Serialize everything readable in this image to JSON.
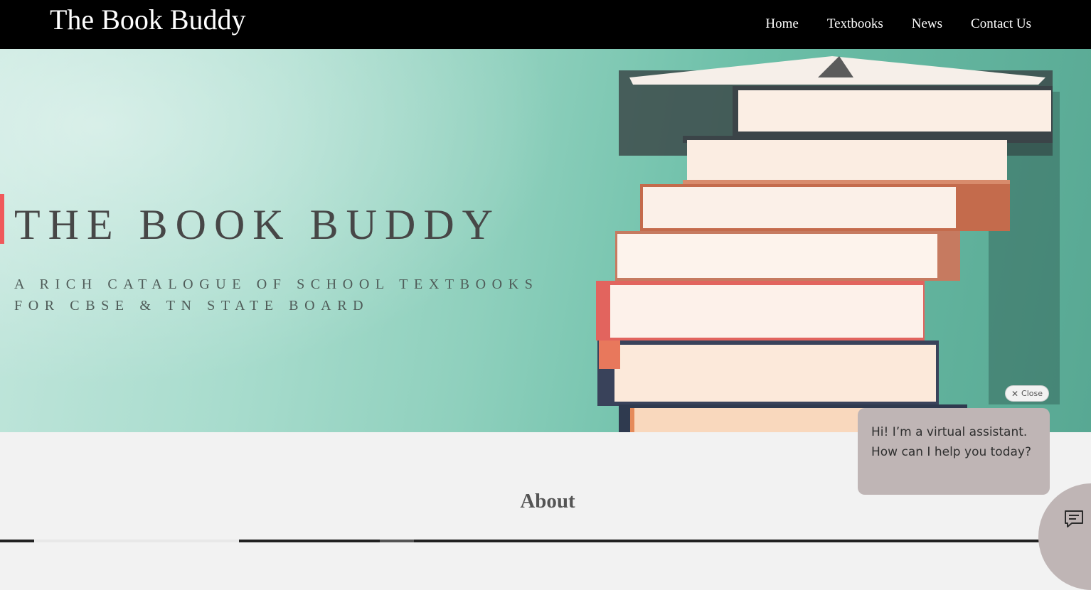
{
  "header": {
    "site_title": "The Book Buddy",
    "nav": [
      {
        "label": "Home"
      },
      {
        "label": "Textbooks"
      },
      {
        "label": "News"
      },
      {
        "label": "Contact Us"
      }
    ]
  },
  "hero": {
    "title": "THE BOOK BUDDY",
    "subtitle": "A RICH CATALOGUE OF SCHOOL TEXTBOOKS FOR CBSE & TN STATE BOARD",
    "accent_color": "#f0595b"
  },
  "about": {
    "title": "About"
  },
  "chat": {
    "close_label": "Close",
    "message": "Hi! I’m a virtual assistant. How can I help you today?",
    "launcher_icon": "chat-icon"
  },
  "colors": {
    "header_bg": "#000000",
    "page_bg": "#f2f2f2",
    "chat_bg": "#bfb5b5"
  }
}
